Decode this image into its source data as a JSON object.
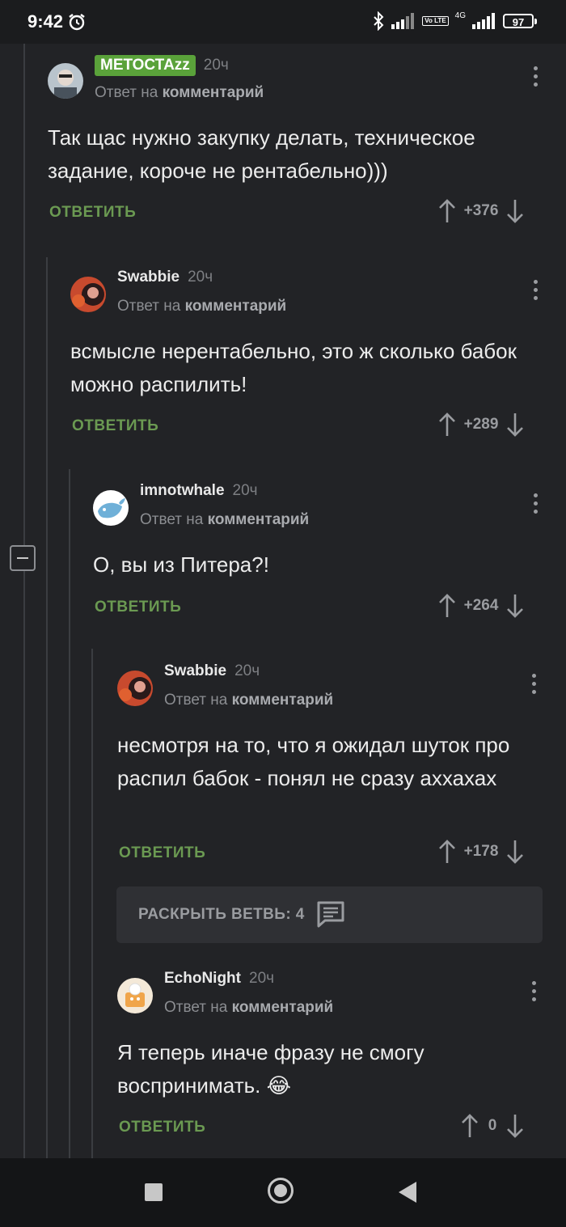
{
  "status_bar": {
    "time": "9:42",
    "battery": "97",
    "network": "4G",
    "volte": "Vo LTE"
  },
  "comments": [
    {
      "author": "МЕТОСТАzz",
      "time": "20ч",
      "reply_prefix": "Ответ на",
      "reply_target": "комментарий",
      "text": "Так щас нужно закупку делать, техническое задание, короче не рентабельно)))",
      "reply_label": "ОТВЕТИТЬ",
      "score": "+376"
    },
    {
      "author": "Swabbie",
      "time": "20ч",
      "reply_prefix": "Ответ на",
      "reply_target": "комментарий",
      "text": "всмысле нерентабельно, это ж сколько бабок можно распилить!",
      "reply_label": "ОТВЕТИТЬ",
      "score": "+289"
    },
    {
      "author": "imnotwhale",
      "time": "20ч",
      "reply_prefix": "Ответ на",
      "reply_target": "комментарий",
      "text": "О, вы из Питера?!",
      "reply_label": "ОТВЕТИТЬ",
      "score": "+264"
    },
    {
      "author": "Swabbie",
      "time": "20ч",
      "reply_prefix": "Ответ на",
      "reply_target": "комментарий",
      "text": "несмотря на то, что я ожидал шуток про распил бабок - понял не сразу аххахах",
      "reply_label": "ОТВЕТИТЬ",
      "score": "+178"
    },
    {
      "author": "EchoNight",
      "time": "20ч",
      "reply_prefix": "Ответ на",
      "reply_target": "комментарий",
      "text": "Я теперь иначе фразу не смогу воспринимать. 😂",
      "reply_label": "ОТВЕТИТЬ",
      "score": "0"
    }
  ],
  "expand_branch": {
    "label": "РАСКРЫТЬ ВЕТВЬ: 4"
  },
  "icons": {
    "collapse": "minus-square-icon",
    "menu": "more-vertical-icon",
    "upvote": "arrow-up-icon",
    "downvote": "arrow-down-icon",
    "expand": "comments-icon"
  },
  "colors": {
    "accent": "#6b9a52",
    "badge": "#5aa23a",
    "background": "#222326"
  }
}
